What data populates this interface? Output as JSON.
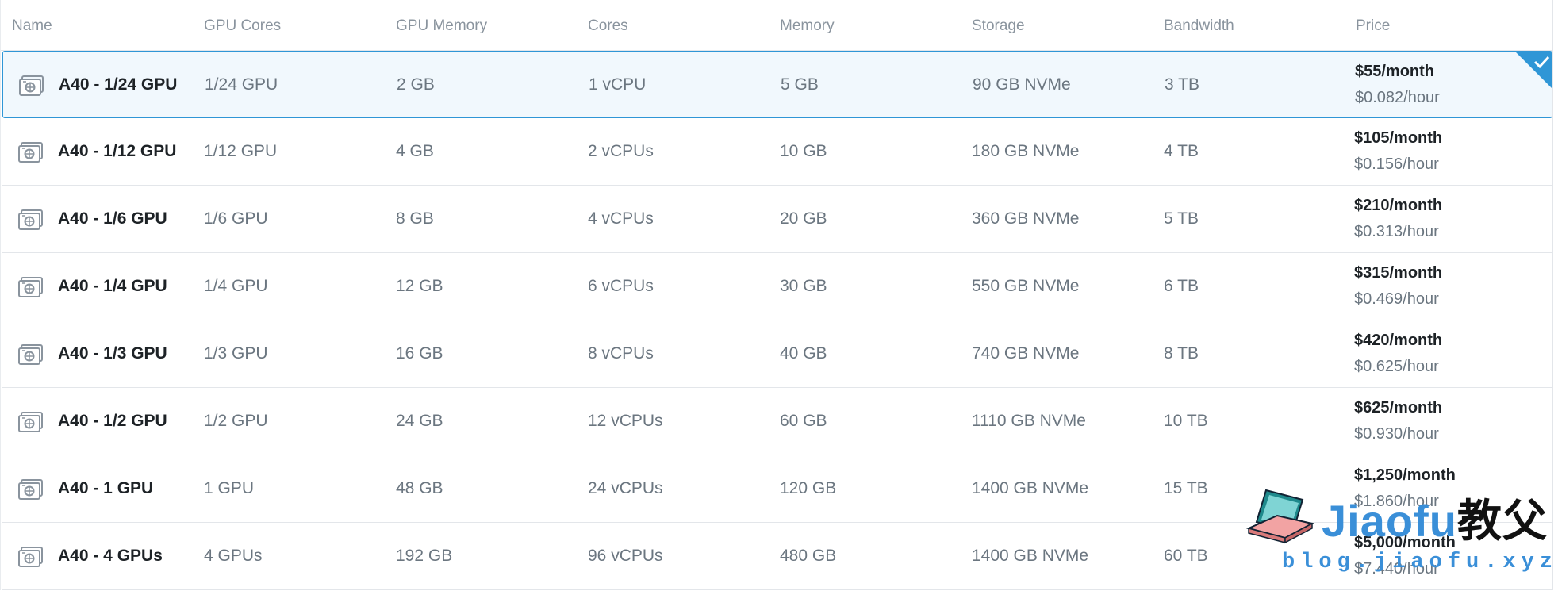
{
  "columns": [
    "Name",
    "GPU Cores",
    "GPU Memory",
    "Cores",
    "Memory",
    "Storage",
    "Bandwidth",
    "Price"
  ],
  "plans": [
    {
      "name": "A40 - 1/24 GPU",
      "gpu_cores": "1/24 GPU",
      "gpu_memory": "2 GB",
      "cores": "1 vCPU",
      "memory": "5 GB",
      "storage": "90 GB NVMe",
      "bandwidth": "3 TB",
      "price_month": "$55/month",
      "price_hour": "$0.082/hour",
      "selected": true
    },
    {
      "name": "A40 - 1/12 GPU",
      "gpu_cores": "1/12 GPU",
      "gpu_memory": "4 GB",
      "cores": "2 vCPUs",
      "memory": "10 GB",
      "storage": "180 GB NVMe",
      "bandwidth": "4 TB",
      "price_month": "$105/month",
      "price_hour": "$0.156/hour",
      "selected": false
    },
    {
      "name": "A40 - 1/6 GPU",
      "gpu_cores": "1/6 GPU",
      "gpu_memory": "8 GB",
      "cores": "4 vCPUs",
      "memory": "20 GB",
      "storage": "360 GB NVMe",
      "bandwidth": "5 TB",
      "price_month": "$210/month",
      "price_hour": "$0.313/hour",
      "selected": false
    },
    {
      "name": "A40 - 1/4 GPU",
      "gpu_cores": "1/4 GPU",
      "gpu_memory": "12 GB",
      "cores": "6 vCPUs",
      "memory": "30 GB",
      "storage": "550 GB NVMe",
      "bandwidth": "6 TB",
      "price_month": "$315/month",
      "price_hour": "$0.469/hour",
      "selected": false
    },
    {
      "name": "A40 - 1/3 GPU",
      "gpu_cores": "1/3 GPU",
      "gpu_memory": "16 GB",
      "cores": "8 vCPUs",
      "memory": "40 GB",
      "storage": "740 GB NVMe",
      "bandwidth": "8 TB",
      "price_month": "$420/month",
      "price_hour": "$0.625/hour",
      "selected": false
    },
    {
      "name": "A40 - 1/2 GPU",
      "gpu_cores": "1/2 GPU",
      "gpu_memory": "24 GB",
      "cores": "12 vCPUs",
      "memory": "60 GB",
      "storage": "1110 GB NVMe",
      "bandwidth": "10 TB",
      "price_month": "$625/month",
      "price_hour": "$0.930/hour",
      "selected": false
    },
    {
      "name": "A40 - 1 GPU",
      "gpu_cores": "1 GPU",
      "gpu_memory": "48 GB",
      "cores": "24 vCPUs",
      "memory": "120 GB",
      "storage": "1400 GB NVMe",
      "bandwidth": "15 TB",
      "price_month": "$1,250/month",
      "price_hour": "$1.860/hour",
      "selected": false
    },
    {
      "name": "A40 - 4 GPUs",
      "gpu_cores": "4 GPUs",
      "gpu_memory": "192 GB",
      "cores": "96 vCPUs",
      "memory": "480 GB",
      "storage": "1400 GB NVMe",
      "bandwidth": "60 TB",
      "price_month": "$5,000/month",
      "price_hour": "$7.440/hour",
      "selected": false
    }
  ],
  "watermark": {
    "brand": "Jiaofu",
    "brand_cn": "教父",
    "url": "blog.jiaofu.xyz"
  },
  "icons": {
    "row_icon": "gpu-card-icon",
    "selected_marker": "checkmark-icon"
  },
  "colors": {
    "accent": "#2f96d6",
    "selected_bg": "#f1f8fd",
    "header_text": "#8a949e",
    "cell_text": "#6b7680",
    "name_text": "#1d2226"
  }
}
